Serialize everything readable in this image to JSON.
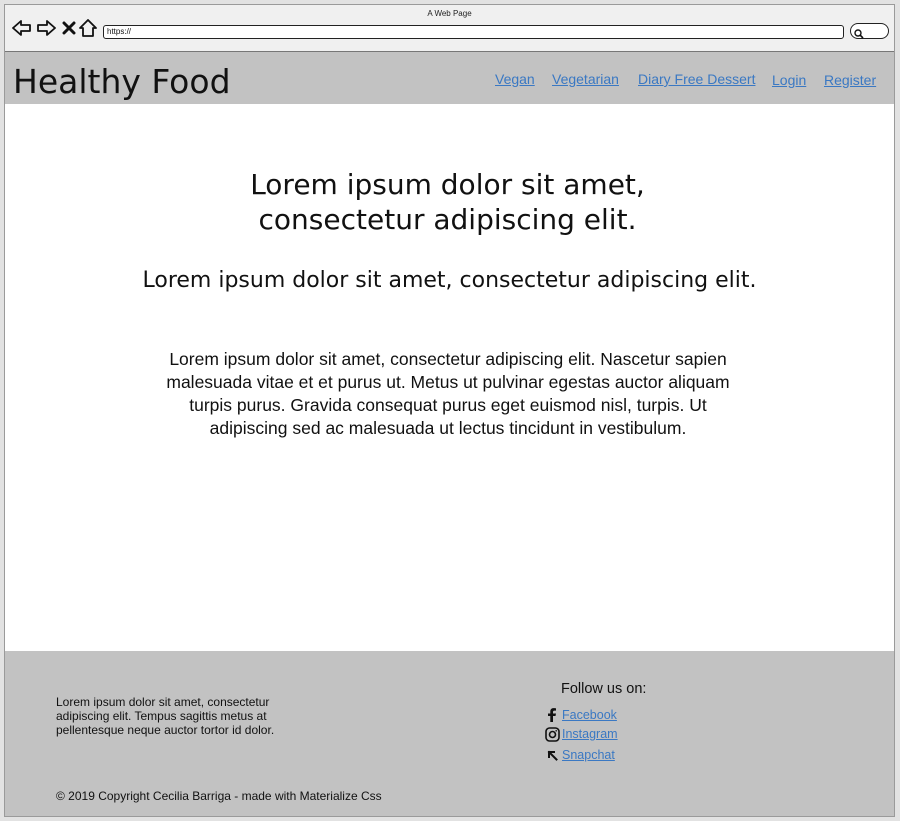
{
  "browser": {
    "window_title": "A Web Page",
    "url": "https://",
    "icons": [
      "back-arrow-icon",
      "forward-arrow-icon",
      "close-x-icon",
      "home-icon",
      "search-icon"
    ]
  },
  "header": {
    "brand": "Healthy Food",
    "nav": [
      {
        "label": "Vegan"
      },
      {
        "label": "Vegetarian"
      },
      {
        "label": "Diary Free Dessert"
      },
      {
        "label": "Login"
      },
      {
        "label": "Register"
      }
    ]
  },
  "main": {
    "heading": "Lorem ipsum dolor sit amet, consectetur adipiscing elit.",
    "subheading": "Lorem ipsum dolor sit amet, consectetur adipiscing elit.",
    "paragraph": "Lorem ipsum dolor sit amet, consectetur adipiscing elit. Nascetur sapien malesuada vitae et et purus ut. Metus ut pulvinar egestas auctor aliquam turpis purus. Gravida consequat purus eget euismod nisl, turpis. Ut adipiscing sed ac malesuada ut lectus tincidunt in vestibulum."
  },
  "footer": {
    "text": "Lorem ipsum dolor sit amet, consectetur adipiscing elit. Tempus sagittis metus at pellentesque neque auctor tortor id dolor.",
    "follow_label": "Follow us on:",
    "social": [
      {
        "label": "Facebook",
        "icon": "facebook-icon"
      },
      {
        "label": "Instagram",
        "icon": "instagram-icon"
      },
      {
        "label": "Snapchat",
        "icon": "snapchat-icon"
      }
    ],
    "copyright": "© 2019 Copyright Cecilia Barriga - made with Materialize Css"
  },
  "colors": {
    "link": "#3a78c3",
    "header_bg": "#c2c2c2",
    "footer_bg": "#c2c2c2",
    "page_bg": "#ffffff"
  }
}
